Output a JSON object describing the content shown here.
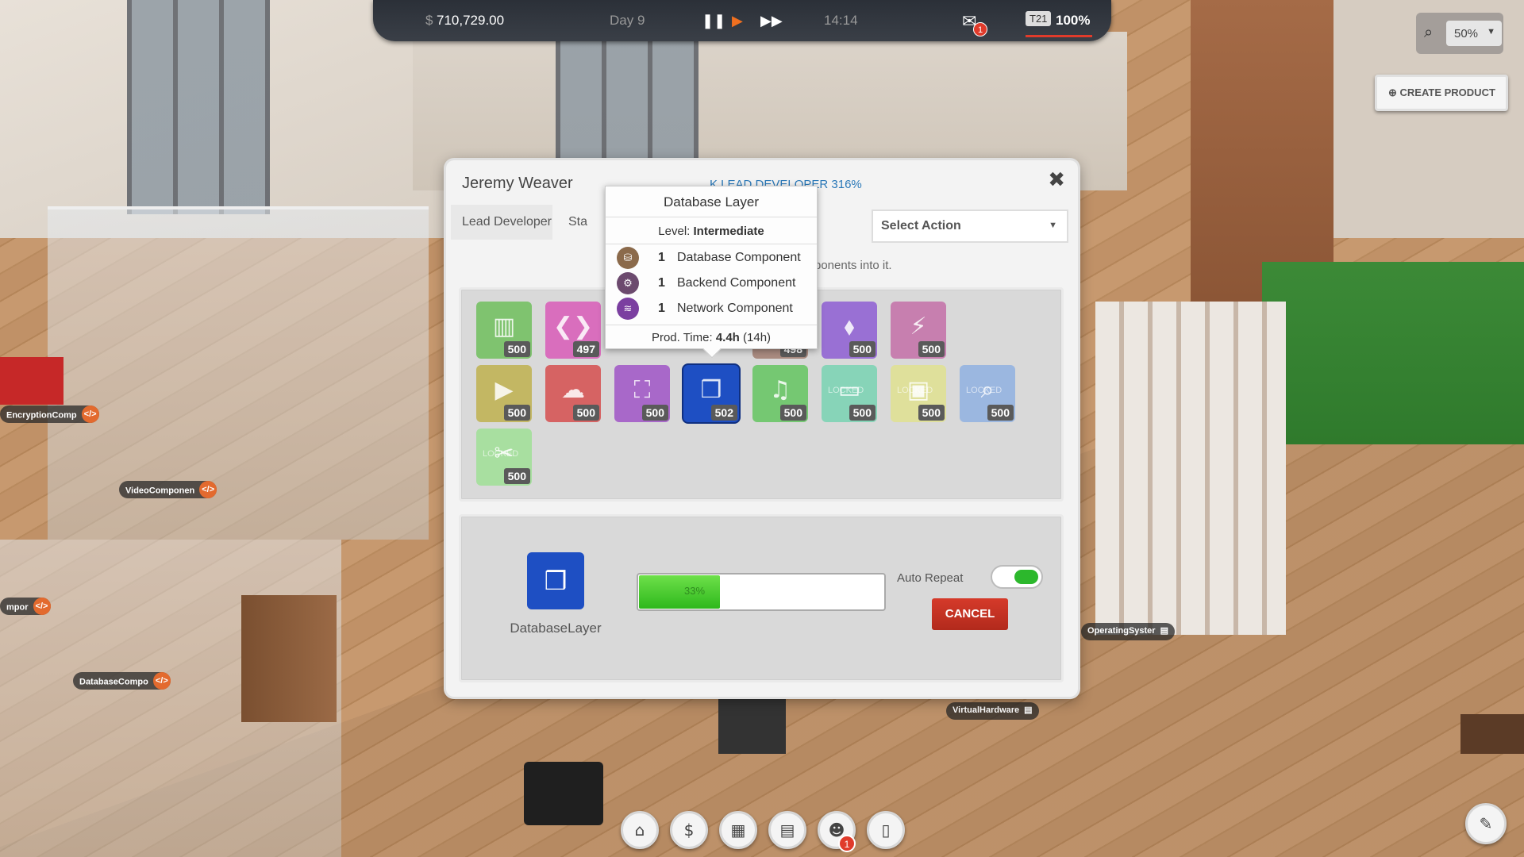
{
  "hud": {
    "money_symbol": "$",
    "money": "710,729.00",
    "day": "Day 9",
    "time": "14:14",
    "mail_count": "1",
    "tier": "T21",
    "tier_percent": "100%"
  },
  "zoom": {
    "value": "50%"
  },
  "create_product": {
    "label": "CREATE PRODUCT"
  },
  "dialog": {
    "employee_name": "Jeremy Weaver",
    "role_line": "K LEAD DEVELOPER 316%",
    "tabs": [
      "Lead Developer",
      "Sta"
    ],
    "select_action": "Select Action",
    "hint_text": "ponents into it.",
    "tiles": [
      {
        "icon": "layout-icon",
        "count": "500",
        "color": "#7fc36f",
        "locked_text": ""
      },
      {
        "icon": "code-file-icon",
        "count": "497",
        "color": "#d96ebd",
        "locked_text": ""
      },
      {
        "icon": "lock-icon",
        "count": "498",
        "color": "#a98b80",
        "locked_text": ""
      },
      {
        "icon": "tag-icon",
        "count": "500",
        "color": "#9970d4",
        "locked_text": ""
      },
      {
        "icon": "plug-icon",
        "count": "500",
        "color": "#c77faf",
        "locked_text": ""
      },
      {
        "icon": "video-file-icon",
        "count": "500",
        "color": "#c3b763",
        "locked_text": ""
      },
      {
        "icon": "cloud-download-icon",
        "count": "500",
        "color": "#d66363",
        "locked_text": ""
      },
      {
        "icon": "drive-icon",
        "count": "500",
        "color": "#a868c9",
        "locked_text": ""
      },
      {
        "icon": "cubes-icon",
        "count": "502",
        "color": "#1e4fc3",
        "locked_text": ""
      },
      {
        "icon": "bell-icon",
        "count": "500",
        "color": "#75c872",
        "locked_text": ""
      },
      {
        "icon": "card-icon",
        "count": "500",
        "color": "#87d4b8",
        "locked_text": "LOCKED"
      },
      {
        "icon": "video-icon",
        "count": "500",
        "color": "#dfe09b",
        "locked_text": "LOCKED"
      },
      {
        "icon": "search-icon",
        "count": "500",
        "color": "#9bb7e0",
        "locked_text": "LOCKED"
      },
      {
        "icon": "crop-icon",
        "count": "500",
        "color": "#a8dfa0",
        "locked_text": "LOCKED"
      }
    ],
    "producing": {
      "name": "DatabaseLayer",
      "progress_percent": 33,
      "progress_text": "33%",
      "auto_repeat_label": "Auto Repeat",
      "auto_repeat_on": true,
      "cancel_label": "CANCEL"
    }
  },
  "tooltip": {
    "title": "Database Layer",
    "level_label": "Level:",
    "level_value": "Intermediate",
    "components": [
      {
        "qty": "1",
        "name": "Database Component",
        "icon": "database-icon",
        "color": "#8b6a4b"
      },
      {
        "qty": "1",
        "name": "Backend Component",
        "icon": "gears-icon",
        "color": "#6c4a6e"
      },
      {
        "qty": "1",
        "name": "Network Component",
        "icon": "wifi-icon",
        "color": "#7b3fa0"
      }
    ],
    "prod_label": "Prod. Time:",
    "prod_value": "4.4h",
    "prod_extra": "(14h)"
  },
  "world_tags": [
    {
      "text": "EncryptionComp",
      "type": "code"
    },
    {
      "text": "VideoComponen",
      "type": "code"
    },
    {
      "text": "mpor",
      "type": "code"
    },
    {
      "text": "DatabaseCompo",
      "type": "code"
    },
    {
      "text": "OperatingSyster",
      "type": "server"
    },
    {
      "text": "VirtualHardware",
      "type": "server"
    }
  ],
  "bottom_bar": {
    "team_badge": "1",
    "buttons": [
      "shop-icon",
      "money-icon",
      "grid-icon",
      "calendar-icon",
      "team-icon",
      "building-icon"
    ]
  }
}
